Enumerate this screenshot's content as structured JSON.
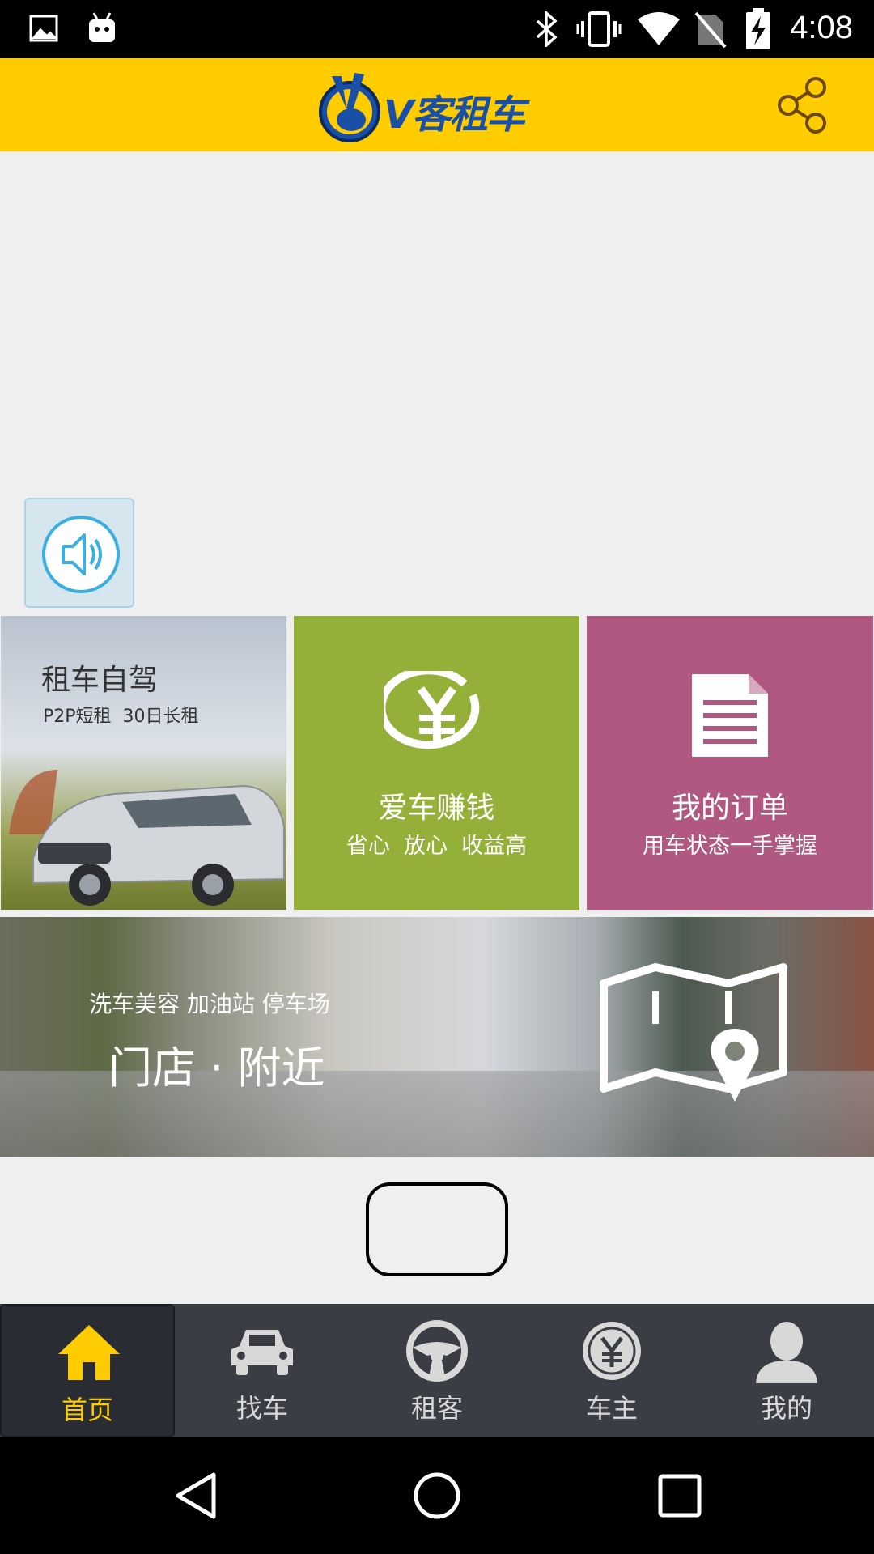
{
  "status_bar": {
    "time": "4:08",
    "icons": [
      "image-icon",
      "android-icon",
      "bluetooth-icon",
      "vibrate-icon",
      "wifi-icon",
      "no-sim-icon",
      "battery-charging-icon"
    ]
  },
  "header": {
    "logo_text": "V客租车",
    "share_icon": "share-icon"
  },
  "tiles": {
    "rent": {
      "title": "租车自驾",
      "subtitle": "P2P短租  30日长租"
    },
    "earn": {
      "title": "爱车赚钱",
      "subtitle": "省心  放心  收益高",
      "color": "#94b038"
    },
    "orders": {
      "title": "我的订单",
      "subtitle": "用车状态一手掌握",
      "color": "#b05882"
    }
  },
  "nearby_banner": {
    "subtitle": "洗车美容 加油站 停车场",
    "title": "门店 · 附近"
  },
  "tabs": [
    {
      "label": "首页",
      "icon": "home-icon",
      "active": true
    },
    {
      "label": "找车",
      "icon": "car-icon"
    },
    {
      "label": "租客",
      "icon": "steering-wheel-icon"
    },
    {
      "label": "车主",
      "icon": "yen-coin-icon"
    },
    {
      "label": "我的",
      "icon": "person-icon"
    }
  ],
  "colors": {
    "accent": "#ffcc00",
    "tabbar": "#3b3d45",
    "logo_blue": "#1a4fa8"
  }
}
